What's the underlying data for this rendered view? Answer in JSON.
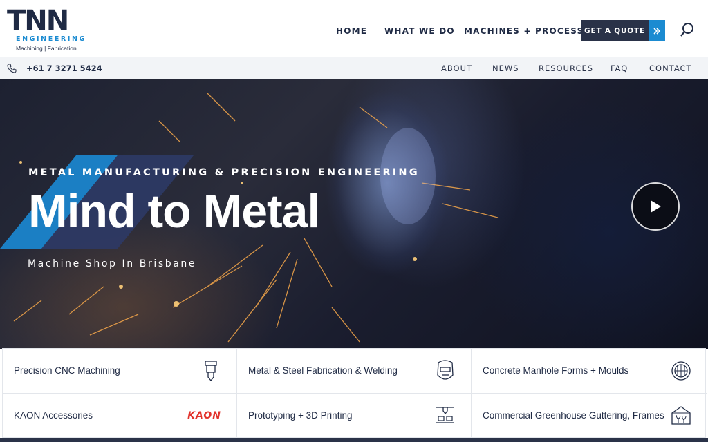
{
  "brand": {
    "name": "TNN",
    "sub": "ENGINEERING",
    "tagline": "Machining | Fabrication"
  },
  "nav": {
    "home": "HOME",
    "what_we_do": "WHAT WE DO",
    "machines": "MACHINES + PROCESSES",
    "quote": "GET A QUOTE"
  },
  "subbar": {
    "phone": "+61 7 3271 5424",
    "links": [
      "ABOUT",
      "NEWS",
      "RESOURCES",
      "FAQ",
      "CONTACT"
    ]
  },
  "hero": {
    "kicker": "METAL MANUFACTURING & PRECISION ENGINEERING",
    "title": "Mind to Metal",
    "subtitle": "Machine Shop In Brisbane"
  },
  "services": [
    {
      "label": "Precision CNC Machining",
      "icon": "cnc-tool-icon"
    },
    {
      "label": "Metal & Steel Fabrication & Welding",
      "icon": "welding-mask-icon"
    },
    {
      "label": "Concrete Manhole Forms + Moulds",
      "icon": "manhole-icon"
    },
    {
      "label": "KAON Accessories",
      "icon": "kaon-logo",
      "logo_text": "KAON"
    },
    {
      "label": "Prototyping + 3D Printing",
      "icon": "3d-printer-icon"
    },
    {
      "label": "Commercial Greenhouse Guttering, Frames",
      "icon": "greenhouse-icon"
    }
  ],
  "colors": {
    "navy": "#2a3248",
    "accent": "#1b8bd1",
    "kaon_red": "#e2322b"
  }
}
